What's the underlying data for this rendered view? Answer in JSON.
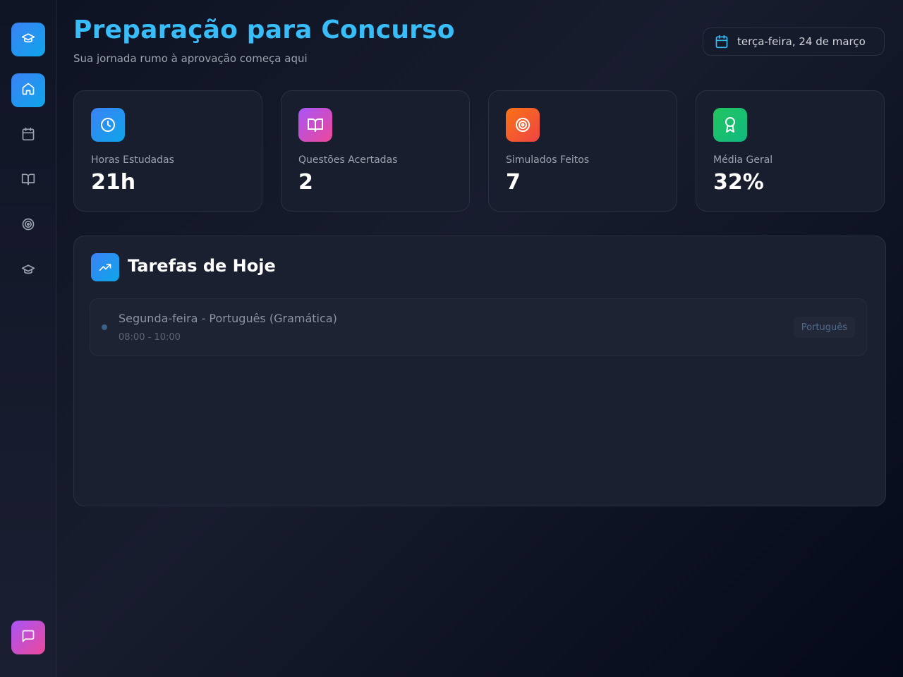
{
  "header": {
    "title": "Preparação para Concurso",
    "subtitle": "Sua jornada rumo à aprovação começa aqui",
    "date": "terça-feira, 24 de março"
  },
  "sidebar": {
    "items": [
      {
        "icon": "graduation-cap-icon",
        "active": true
      },
      {
        "icon": "home-icon",
        "active": true
      },
      {
        "icon": "calendar-icon",
        "active": false
      },
      {
        "icon": "book-open-icon",
        "active": false
      },
      {
        "icon": "target-icon",
        "active": false
      },
      {
        "icon": "graduation-cap-icon",
        "active": false
      }
    ],
    "chat_icon": "message-square-icon"
  },
  "stats": [
    {
      "label": "Horas Estudadas",
      "value": "21h",
      "icon": "clock-icon",
      "color": "#3b82f6"
    },
    {
      "label": "Questões Acertadas",
      "value": "2",
      "icon": "book-open-icon",
      "color": "#c026d3"
    },
    {
      "label": "Simulados Feitos",
      "value": "7",
      "icon": "target-icon",
      "color": "#f97316"
    },
    {
      "label": "Média Geral",
      "value": "32%",
      "icon": "award-icon",
      "color": "#22c55e"
    }
  ],
  "tasks_panel": {
    "title": "Tarefas de Hoje",
    "icon": "trending-up-icon",
    "tasks": [
      {
        "title": "Segunda-feira - Português (Gramática)",
        "time": "08:00 - 10:00",
        "subject": "Português"
      }
    ]
  },
  "colors": {
    "accent": "#38bdf8",
    "background": "#0d1222",
    "card": "#191e2e"
  }
}
